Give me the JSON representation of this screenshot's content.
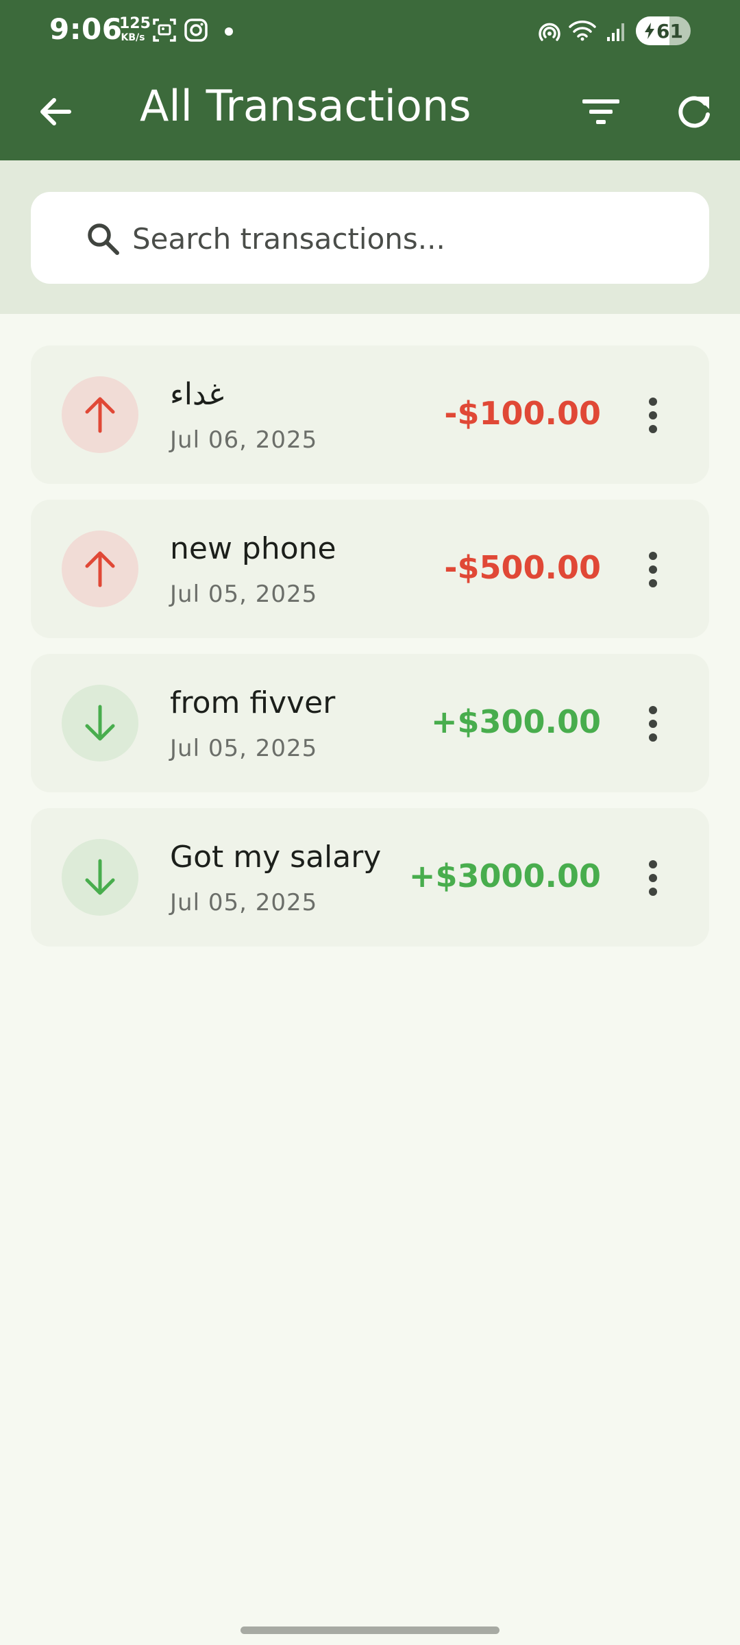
{
  "status_bar": {
    "time": "9:06",
    "net_speed_value": "125",
    "net_speed_unit": "KB/s",
    "battery_level": "61",
    "icons": [
      "screenshot-icon",
      "instagram-icon",
      "notification-dot",
      "hotspot-icon",
      "wifi-icon",
      "signal-icon",
      "battery-icon"
    ]
  },
  "app_bar": {
    "title": "All Transactions",
    "back_icon": "arrow-back-icon",
    "filter_icon": "filter-icon",
    "refresh_icon": "refresh-icon"
  },
  "search": {
    "placeholder": "Search transactions...",
    "value": ""
  },
  "transactions": [
    {
      "name": "غداء",
      "date": "Jul 06, 2025",
      "amount": "-$100.00",
      "type": "expense"
    },
    {
      "name": "new phone",
      "date": "Jul 05, 2025",
      "amount": "-$500.00",
      "type": "expense"
    },
    {
      "name": "from fivver",
      "date": "Jul 05, 2025",
      "amount": "+$300.00",
      "type": "income"
    },
    {
      "name": "Got my salary",
      "date": "Jul 05, 2025",
      "amount": "+$3000.00",
      "type": "income"
    }
  ],
  "colors": {
    "primary": "#3c6a3b",
    "search_band": "#e2eadb",
    "background": "#f6f9f1",
    "card": "#eff3e9",
    "expense": "#e04836",
    "income": "#48ad4d"
  }
}
